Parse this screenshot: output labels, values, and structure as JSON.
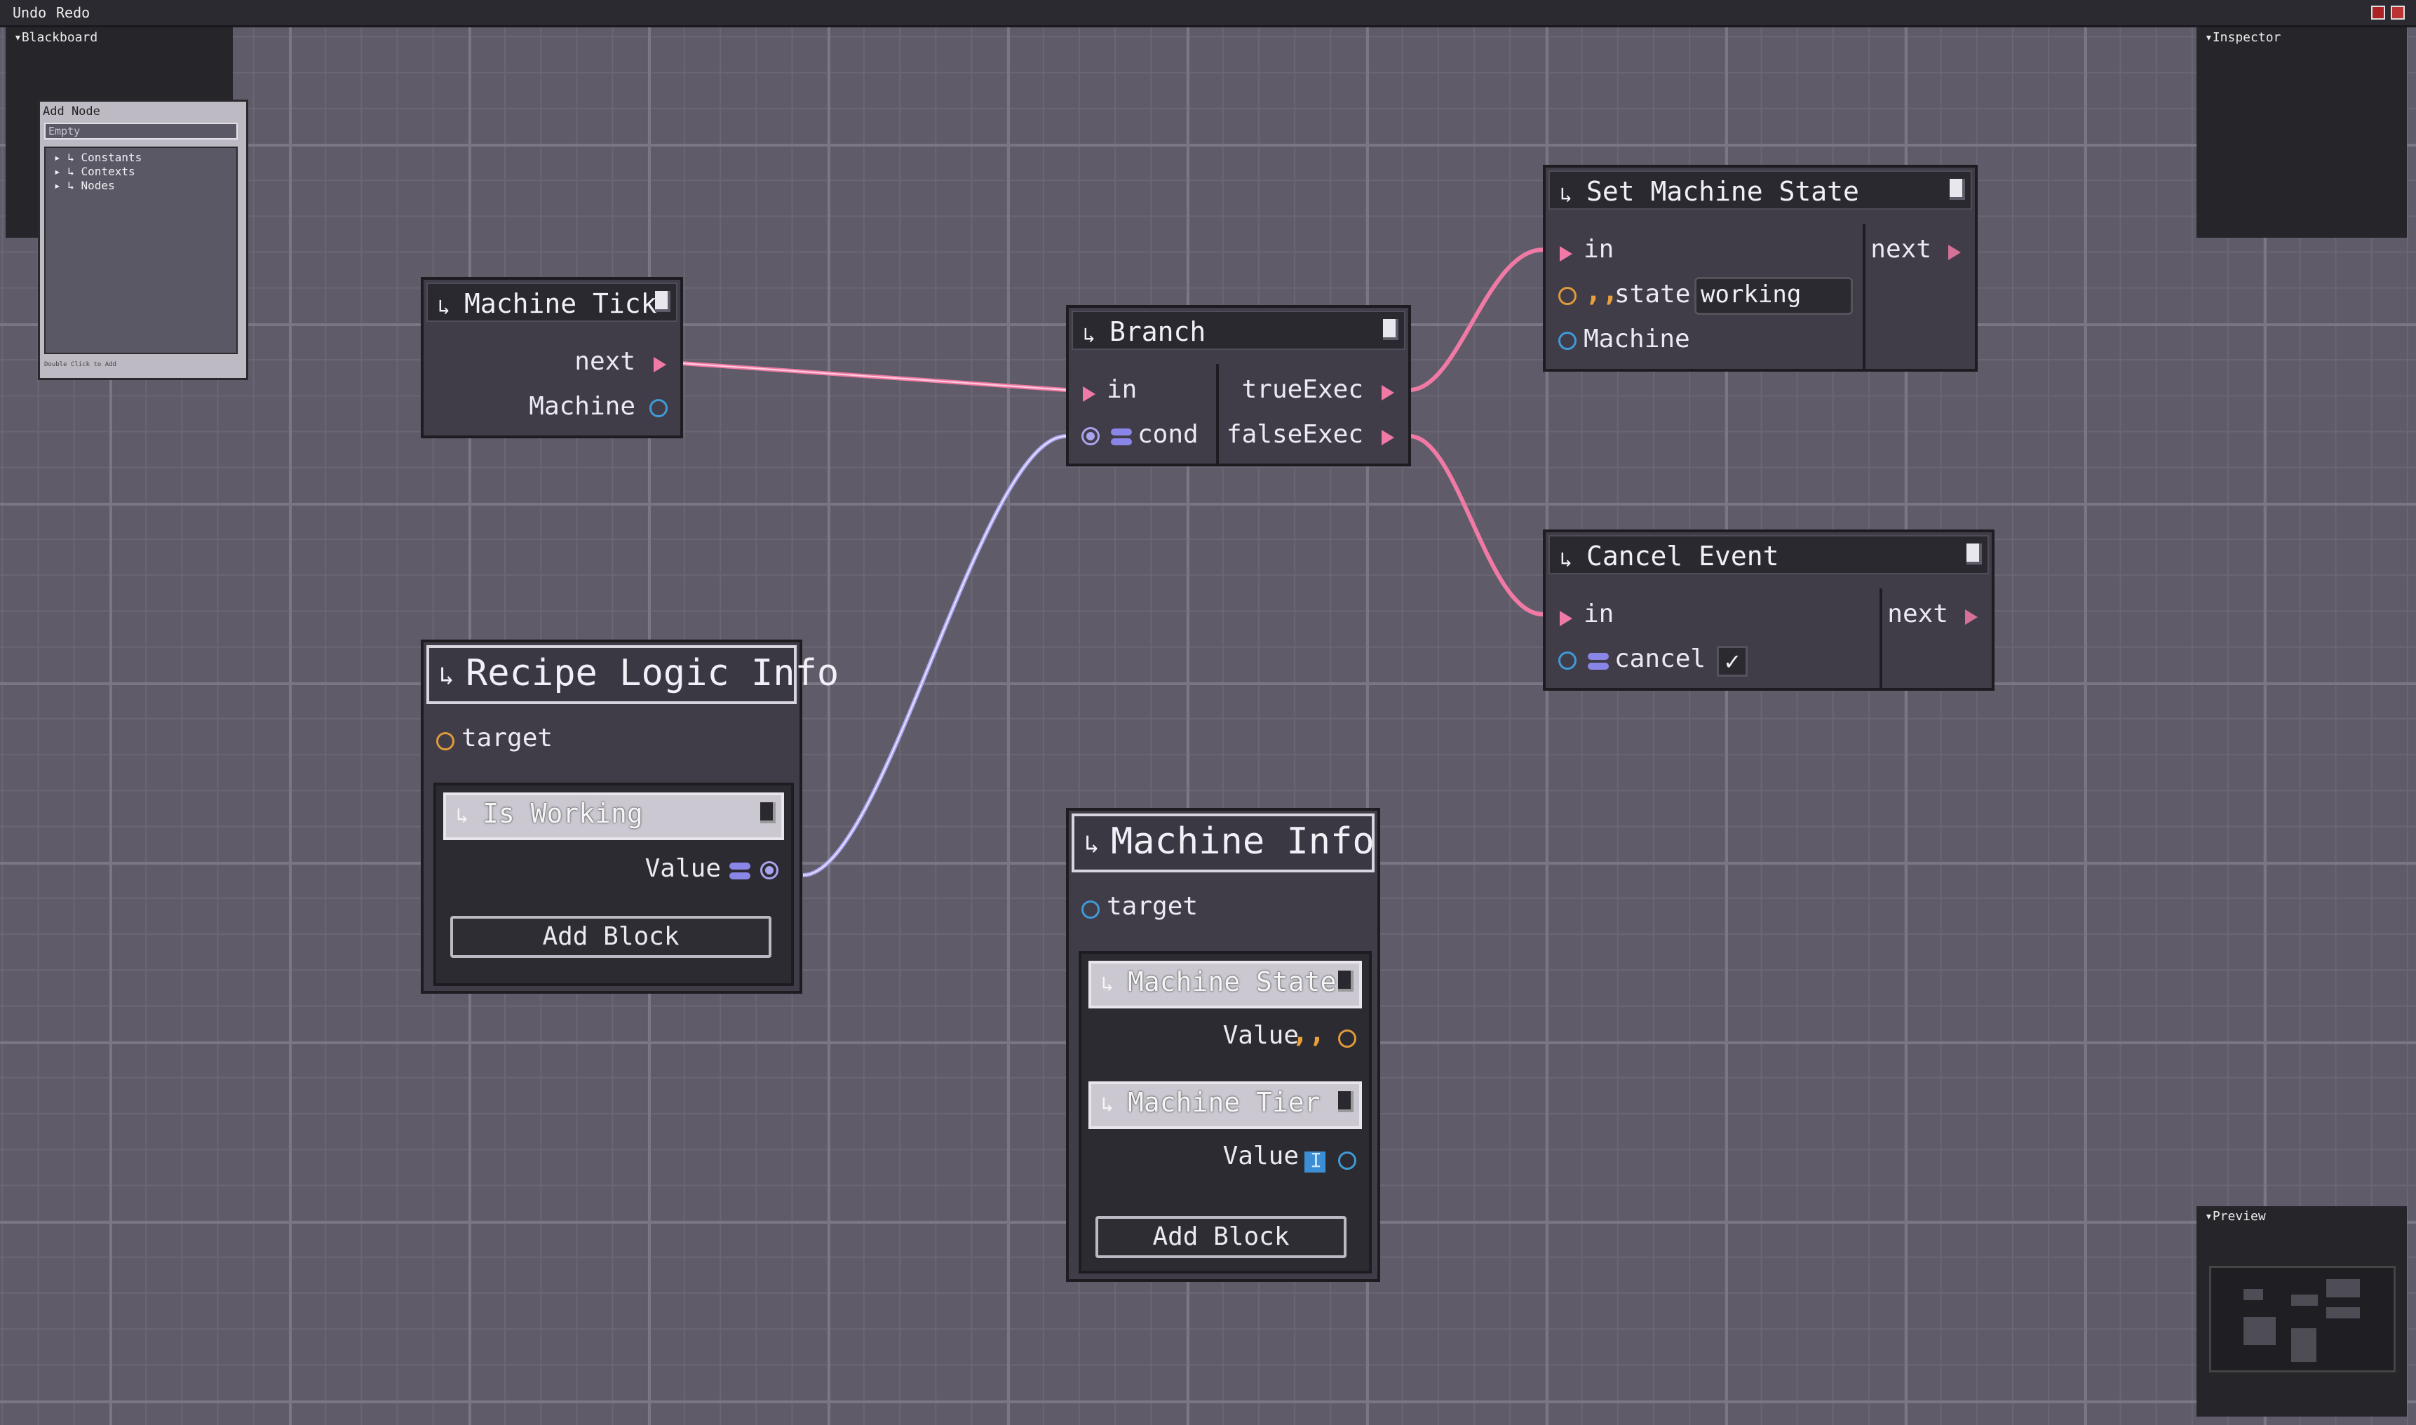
{
  "toolbar": {
    "undo": "Undo",
    "redo": "Redo"
  },
  "panels": {
    "blackboard": "▾Blackboard",
    "inspector": "▾Inspector",
    "preview": "▾Preview"
  },
  "add_node": {
    "title": "Add Node",
    "search_placeholder": "Empty",
    "items": [
      "▸ ↳ Constants",
      "▸ ↳ Contexts",
      "▸ ↳ Nodes"
    ],
    "footer": "Double Click to Add"
  },
  "nodes": {
    "machine_tick": {
      "title": "Machine Tick",
      "outputs": [
        "next",
        "Machine"
      ]
    },
    "branch": {
      "title": "Branch",
      "inputs": [
        "in",
        "cond"
      ],
      "outputs": [
        "trueExec",
        "falseExec"
      ]
    },
    "set_machine_state": {
      "title": "Set Machine State",
      "inputs": [
        "in",
        "state",
        "Machine"
      ],
      "state_value": "working",
      "outputs": [
        "next"
      ]
    },
    "cancel_event": {
      "title": "Cancel Event",
      "inputs": [
        "in",
        "cancel"
      ],
      "cancel_check": "✓",
      "outputs": [
        "next"
      ]
    },
    "recipe_logic_info": {
      "title": "Recipe Logic Info",
      "input": "target",
      "block_title": "Is Working",
      "block_value": "Value",
      "add_block": "Add Block"
    },
    "machine_info": {
      "title": "Machine Info",
      "input": "target",
      "block1_title": "Machine State",
      "block1_value": "Value",
      "block2_title": "Machine Tier",
      "block2_value": "Value",
      "add_block": "Add Block"
    }
  },
  "colors": {
    "exec": "#f07aa5",
    "bool": "#a9a2ee",
    "string": "#e09a3a",
    "object": "#3f9bd8"
  }
}
